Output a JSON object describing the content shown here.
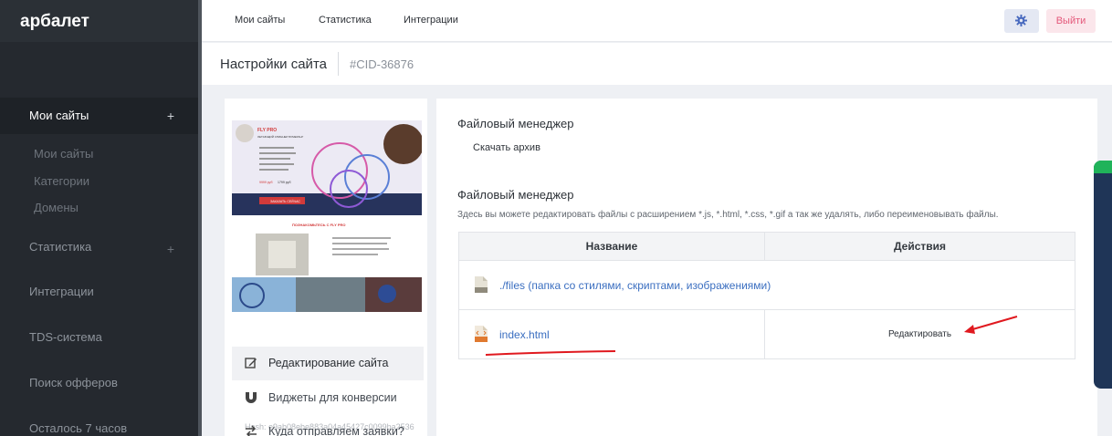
{
  "app": {
    "logo": "арбалет"
  },
  "sidebar": {
    "active": {
      "label": "Мои сайты",
      "plus": "+"
    },
    "sub": [
      "Мои сайты",
      "Категории",
      "Домены"
    ],
    "stats": {
      "label": "Статистика",
      "plus": "+"
    },
    "items": [
      "Интеграции",
      "TDS-система",
      "Поиск офферов",
      "Осталось 7 часов"
    ]
  },
  "topnav": {
    "my_sites": "Мои сайты",
    "stats": "Статистика",
    "integrations": "Интеграции",
    "logout": "Выйти"
  },
  "header": {
    "title": "Настройки сайта",
    "cid": "#CID-36876"
  },
  "preview": {
    "brand": "FLY PRO",
    "tagline": "ЛЕТАЮЩИЙ СПИННЕР БУМЕРАНГ",
    "price_new": "9999 руб",
    "price_old": "1799 руб",
    "cta": "ЗАКАЗАТЬ СЕЙЧАС",
    "banner": "ПОЗНАКОМЬТЕСЬ С FLY PRO"
  },
  "site": {
    "hash": "Hash: e9ab08ebe883a04a45427c0099ba2536",
    "menu": [
      "Редактирование сайта",
      "Виджеты для конверсии",
      "Куда отправляем заявки?"
    ]
  },
  "file_manager": {
    "title1": "Файловый менеджер",
    "download": "Скачать архив",
    "title2": "Файловый менеджер",
    "description": "Здесь вы можете редактировать файлы с расширением *.js, *.html, *.css, *.gif а так же удалять, либо переименовывать файлы.",
    "columns": [
      "Название",
      "Действия"
    ],
    "rows": [
      {
        "name": "./files (папка со стилями, скриптами, изображениями)",
        "action": ""
      },
      {
        "name": "index.html",
        "action": "Редактировать"
      }
    ]
  },
  "colors": {
    "sidebar": "#25292f",
    "link": "#3a6ec0",
    "logout": "#e4587a",
    "annotation": "#e0191f"
  }
}
